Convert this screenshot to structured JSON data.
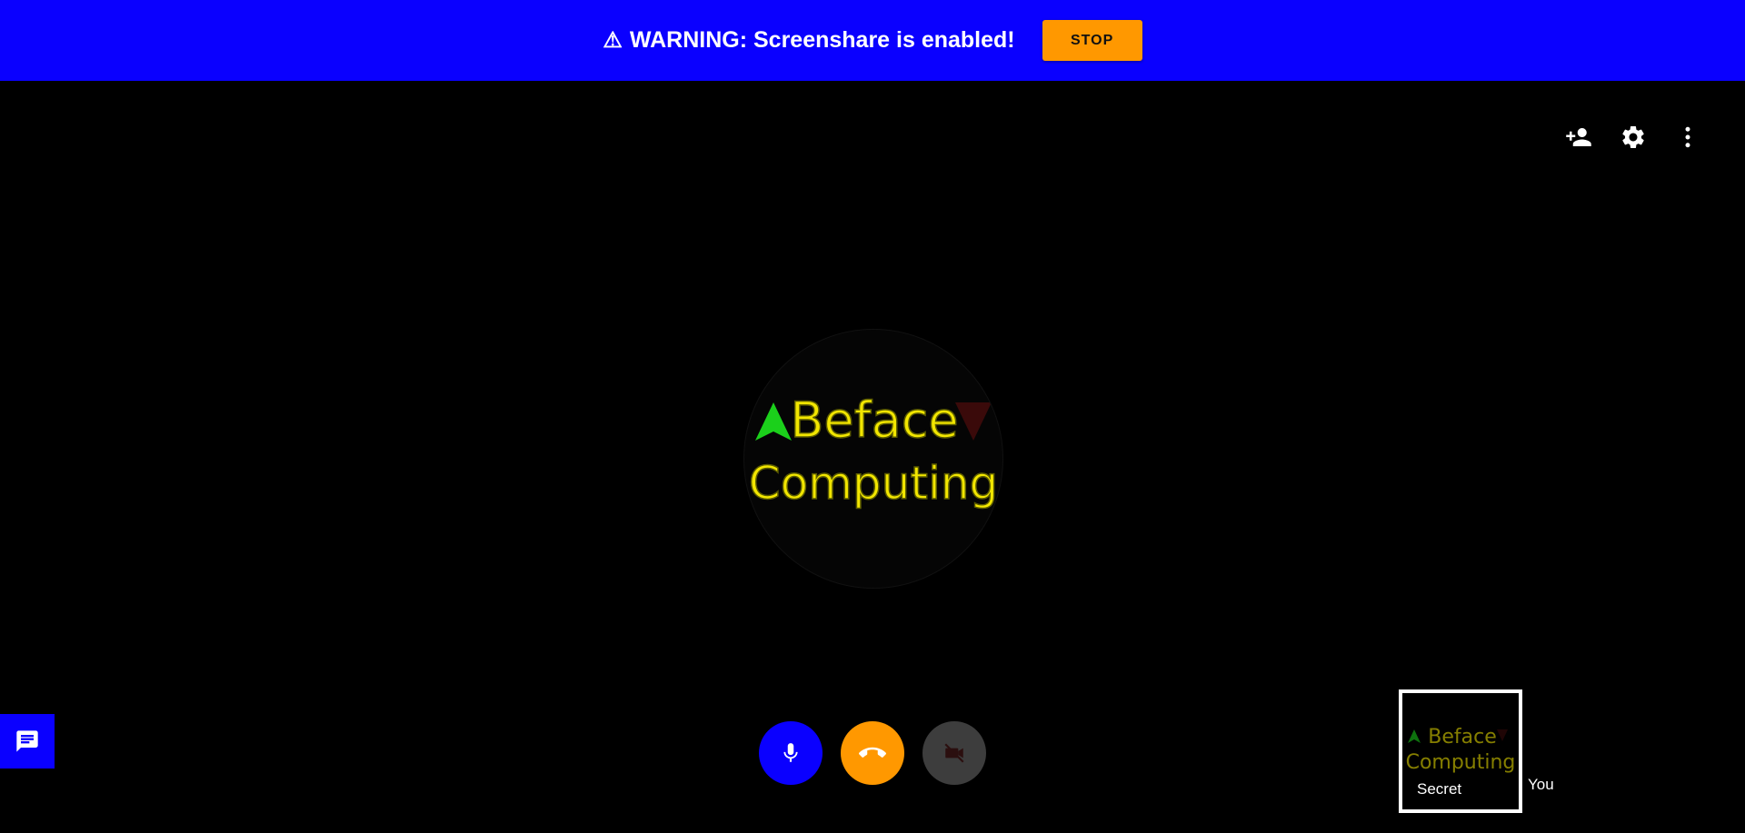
{
  "banner": {
    "warning_icon": "⚠",
    "message": "WARNING: Screenshare is enabled!",
    "stop_label": "STOP",
    "color": "#0a00ff",
    "stop_color": "#ff9800"
  },
  "header_actions": [
    {
      "icon": "add-person-icon"
    },
    {
      "icon": "settings-gear-icon"
    },
    {
      "icon": "more-vertical-icon"
    }
  ],
  "main_avatar": {
    "logo_line1": "Beface",
    "logo_line2": "Computing"
  },
  "controls": [
    {
      "icon": "microphone-icon",
      "color": "#0a00ff"
    },
    {
      "icon": "phone-hangup-icon",
      "color": "#ff9800"
    },
    {
      "icon": "video-off-icon",
      "color": "#3d3d3d"
    }
  ],
  "chat": {
    "icon": "chat-icon"
  },
  "self_view": {
    "name": "Secret",
    "you_label": "You"
  }
}
